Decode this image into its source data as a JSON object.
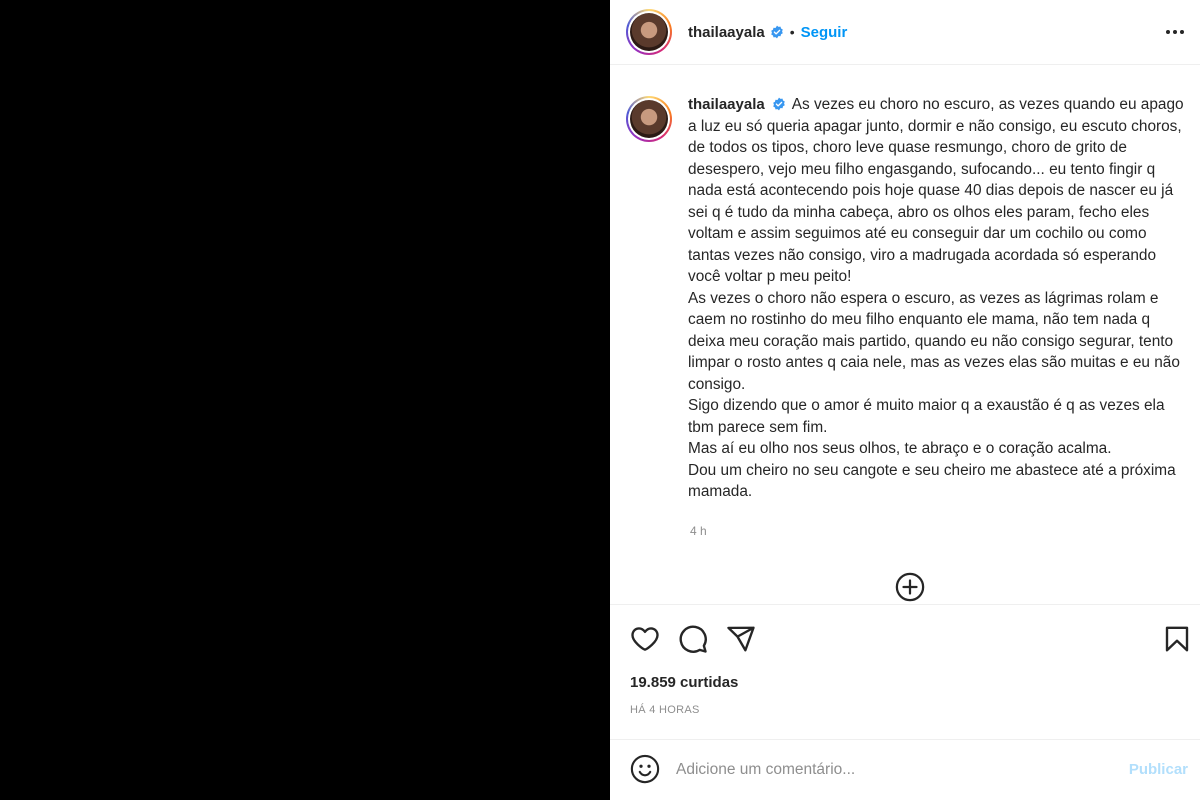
{
  "post": {
    "username": "thailaayala",
    "follow_label": "Seguir",
    "separator": "•",
    "caption": "As vezes eu choro no escuro, as vezes quando eu apago a luz eu só queria apagar junto, dormir e não consigo, eu escuto choros, de todos os tipos, choro leve quase resmungo, choro de grito de desespero, vejo meu filho engasgando, sufocando... eu tento fingir q nada está acontecendo pois hoje quase 40 dias depois de nascer eu já sei q é tudo da minha cabeça, abro os olhos eles param, fecho eles voltam e assim seguimos até eu conseguir dar um cochilo ou como tantas vezes não consigo, viro a madrugada acordada só esperando você voltar p meu peito!\nAs vezes o choro não espera o escuro, as vezes as lágrimas rolam e caem no rostinho do meu filho enquanto ele mama, não tem nada q deixa meu coração mais partido, quando eu não consigo segurar, tento limpar o rosto antes q caia nele, mas as vezes elas são muitas e eu não consigo.\nSigo dizendo que o amor é muito maior q a exaustão é q as vezes ela tbm parece sem fim.\nMas aí eu olho nos seus olhos, te abraço e o coração acalma.\nDou um cheiro no seu cangote e seu cheiro me abastece até a próxima mamada.",
    "caption_time": "4 h",
    "likes": "19.859 curtidas",
    "posted_ago": "HÁ 4 HORAS"
  },
  "comment": {
    "placeholder": "Adicione um comentário...",
    "publish_label": "Publicar"
  },
  "icons": {
    "verified": "verified-badge-icon",
    "more": "more-options-icon",
    "load_more": "plus-circle-icon",
    "like": "heart-icon",
    "comment": "comment-bubble-icon",
    "share": "paper-plane-icon",
    "save": "bookmark-icon",
    "emoji": "emoji-smile-icon"
  },
  "colors": {
    "accent_blue": "#0095f6",
    "publish_disabled": "#b2dffc",
    "muted_text": "#8e8e8e",
    "verified_blue": "#3897f0"
  }
}
